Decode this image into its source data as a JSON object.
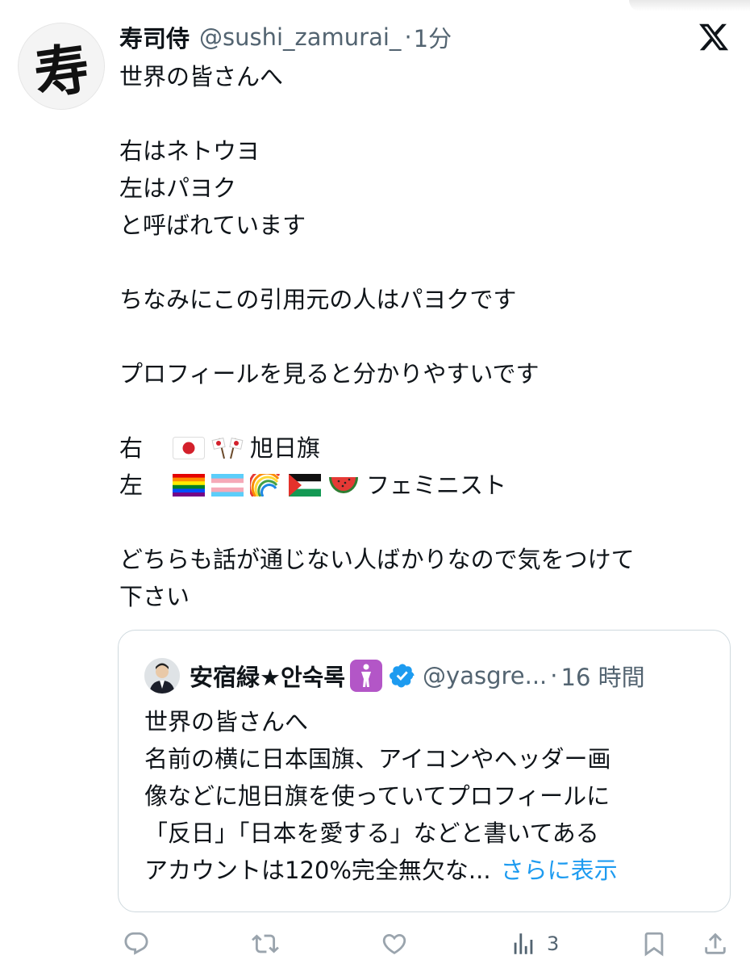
{
  "author": {
    "display_name": "寿司侍",
    "handle": "@sushi_zamurai_",
    "separator": "·",
    "time": "1分",
    "avatar_glyph": "寿"
  },
  "brand_icon": "x-logo-icon",
  "tweet_lines": {
    "l1": "世界の皆さんへ",
    "l2": "右はネトウヨ",
    "l3": "左はパヨク",
    "l4": "と呼ばれています",
    "l5": "ちなみにこの引用元の人はパヨクです",
    "l6": "プロフィールを見ると分かりやすいです",
    "right_label": "右",
    "right_flags": [
      "japan-flag-icon",
      "crossed-flags-icon"
    ],
    "right_suffix": "旭日旗",
    "left_label": "左",
    "left_flags": [
      "rainbow-flag-icon",
      "transgender-flag-icon",
      "rainbow-icon",
      "palestine-flag-icon",
      "watermelon-icon"
    ],
    "left_suffix": "フェミニスト",
    "l7": "どちらも話が通じない人ばかりなので気をつけて",
    "l8": "下さい"
  },
  "quote": {
    "display_name": "安宿緑★안숙록",
    "badge_icon": "person-badge-icon",
    "verified_icon": "verified-badge-icon",
    "handle": "@yasgre...",
    "separator": "·",
    "time": "16 時間",
    "lines": {
      "l1": "世界の皆さんへ",
      "l2": "名前の横に日本国旗、アイコンやヘッダー画",
      "l3": "像などに旭日旗を使っていてプロフィールに",
      "l4": "「反日」「日本を愛する」などと書いてある",
      "l5": "アカウントは120%完全無欠な..."
    },
    "show_more": "さらに表示"
  },
  "actions": {
    "views_count": "3"
  },
  "colors": {
    "text": "#0f1419",
    "secondary": "#536471",
    "link": "#1d9bf0",
    "border": "#cfd9de",
    "icon": "#9aa4ad"
  }
}
